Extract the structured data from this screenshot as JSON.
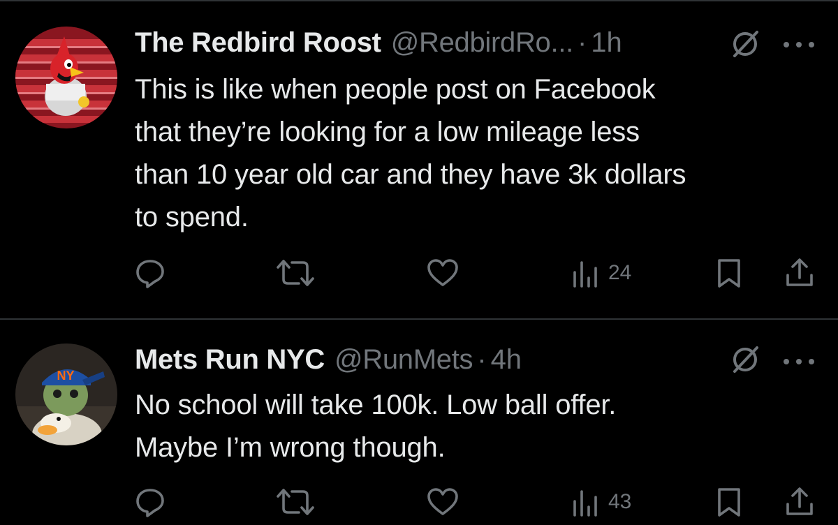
{
  "tweets": [
    {
      "author": "The Redbird Roost",
      "handle": "@RedbirdRo...",
      "separator": "·",
      "time": "1h",
      "text_lines": [
        "This is like when people post on Facebook",
        "that they’re looking for a low mileage less",
        "than 10 year old car and they have 3k dollars",
        "to spend."
      ],
      "views": "24",
      "avatar_icon": "cardinal-mascot-avatar"
    },
    {
      "author": "Mets Run NYC",
      "handle": "@RunMets",
      "separator": "·",
      "time": "4h",
      "text_lines": [
        "No school will take 100k. Low ball offer.",
        "Maybe I’m wrong though."
      ],
      "views": "43",
      "avatar_icon": "green-creature-mets-cap-avatar"
    }
  ],
  "icons": {
    "reply": "reply-icon",
    "retweet": "retweet-icon",
    "like": "heart-icon",
    "views": "views-icon",
    "bookmark": "bookmark-icon",
    "share": "share-icon",
    "grok": "grok-icon",
    "more": "more-icon"
  },
  "colors": {
    "background": "#000000",
    "primary_text": "#e7e9ea",
    "secondary_text": "#71767b",
    "divider": "#2f3336",
    "mets_blue": "#1d4fa3",
    "mets_orange": "#ff6a13"
  }
}
